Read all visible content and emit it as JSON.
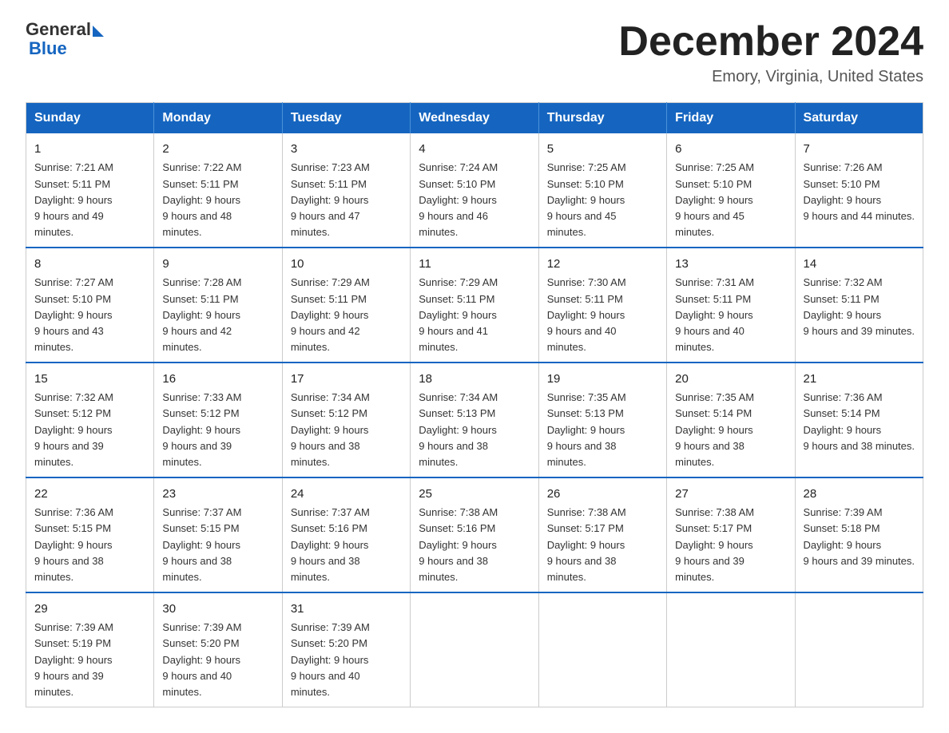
{
  "logo": {
    "general": "General",
    "blue": "Blue"
  },
  "title": "December 2024",
  "location": "Emory, Virginia, United States",
  "weekdays": [
    "Sunday",
    "Monday",
    "Tuesday",
    "Wednesday",
    "Thursday",
    "Friday",
    "Saturday"
  ],
  "weeks": [
    [
      {
        "day": "1",
        "sunrise": "7:21 AM",
        "sunset": "5:11 PM",
        "daylight": "9 hours and 49 minutes."
      },
      {
        "day": "2",
        "sunrise": "7:22 AM",
        "sunset": "5:11 PM",
        "daylight": "9 hours and 48 minutes."
      },
      {
        "day": "3",
        "sunrise": "7:23 AM",
        "sunset": "5:11 PM",
        "daylight": "9 hours and 47 minutes."
      },
      {
        "day": "4",
        "sunrise": "7:24 AM",
        "sunset": "5:10 PM",
        "daylight": "9 hours and 46 minutes."
      },
      {
        "day": "5",
        "sunrise": "7:25 AM",
        "sunset": "5:10 PM",
        "daylight": "9 hours and 45 minutes."
      },
      {
        "day": "6",
        "sunrise": "7:25 AM",
        "sunset": "5:10 PM",
        "daylight": "9 hours and 45 minutes."
      },
      {
        "day": "7",
        "sunrise": "7:26 AM",
        "sunset": "5:10 PM",
        "daylight": "9 hours and 44 minutes."
      }
    ],
    [
      {
        "day": "8",
        "sunrise": "7:27 AM",
        "sunset": "5:10 PM",
        "daylight": "9 hours and 43 minutes."
      },
      {
        "day": "9",
        "sunrise": "7:28 AM",
        "sunset": "5:11 PM",
        "daylight": "9 hours and 42 minutes."
      },
      {
        "day": "10",
        "sunrise": "7:29 AM",
        "sunset": "5:11 PM",
        "daylight": "9 hours and 42 minutes."
      },
      {
        "day": "11",
        "sunrise": "7:29 AM",
        "sunset": "5:11 PM",
        "daylight": "9 hours and 41 minutes."
      },
      {
        "day": "12",
        "sunrise": "7:30 AM",
        "sunset": "5:11 PM",
        "daylight": "9 hours and 40 minutes."
      },
      {
        "day": "13",
        "sunrise": "7:31 AM",
        "sunset": "5:11 PM",
        "daylight": "9 hours and 40 minutes."
      },
      {
        "day": "14",
        "sunrise": "7:32 AM",
        "sunset": "5:11 PM",
        "daylight": "9 hours and 39 minutes."
      }
    ],
    [
      {
        "day": "15",
        "sunrise": "7:32 AM",
        "sunset": "5:12 PM",
        "daylight": "9 hours and 39 minutes."
      },
      {
        "day": "16",
        "sunrise": "7:33 AM",
        "sunset": "5:12 PM",
        "daylight": "9 hours and 39 minutes."
      },
      {
        "day": "17",
        "sunrise": "7:34 AM",
        "sunset": "5:12 PM",
        "daylight": "9 hours and 38 minutes."
      },
      {
        "day": "18",
        "sunrise": "7:34 AM",
        "sunset": "5:13 PM",
        "daylight": "9 hours and 38 minutes."
      },
      {
        "day": "19",
        "sunrise": "7:35 AM",
        "sunset": "5:13 PM",
        "daylight": "9 hours and 38 minutes."
      },
      {
        "day": "20",
        "sunrise": "7:35 AM",
        "sunset": "5:14 PM",
        "daylight": "9 hours and 38 minutes."
      },
      {
        "day": "21",
        "sunrise": "7:36 AM",
        "sunset": "5:14 PM",
        "daylight": "9 hours and 38 minutes."
      }
    ],
    [
      {
        "day": "22",
        "sunrise": "7:36 AM",
        "sunset": "5:15 PM",
        "daylight": "9 hours and 38 minutes."
      },
      {
        "day": "23",
        "sunrise": "7:37 AM",
        "sunset": "5:15 PM",
        "daylight": "9 hours and 38 minutes."
      },
      {
        "day": "24",
        "sunrise": "7:37 AM",
        "sunset": "5:16 PM",
        "daylight": "9 hours and 38 minutes."
      },
      {
        "day": "25",
        "sunrise": "7:38 AM",
        "sunset": "5:16 PM",
        "daylight": "9 hours and 38 minutes."
      },
      {
        "day": "26",
        "sunrise": "7:38 AM",
        "sunset": "5:17 PM",
        "daylight": "9 hours and 38 minutes."
      },
      {
        "day": "27",
        "sunrise": "7:38 AM",
        "sunset": "5:17 PM",
        "daylight": "9 hours and 39 minutes."
      },
      {
        "day": "28",
        "sunrise": "7:39 AM",
        "sunset": "5:18 PM",
        "daylight": "9 hours and 39 minutes."
      }
    ],
    [
      {
        "day": "29",
        "sunrise": "7:39 AM",
        "sunset": "5:19 PM",
        "daylight": "9 hours and 39 minutes."
      },
      {
        "day": "30",
        "sunrise": "7:39 AM",
        "sunset": "5:20 PM",
        "daylight": "9 hours and 40 minutes."
      },
      {
        "day": "31",
        "sunrise": "7:39 AM",
        "sunset": "5:20 PM",
        "daylight": "9 hours and 40 minutes."
      },
      null,
      null,
      null,
      null
    ]
  ]
}
